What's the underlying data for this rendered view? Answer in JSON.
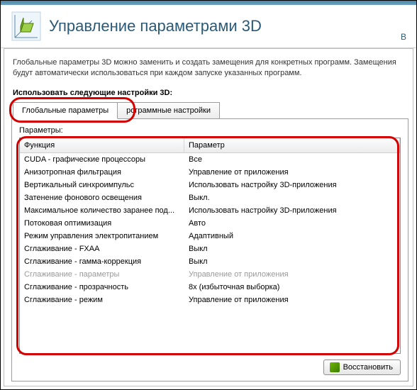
{
  "header": {
    "title": "Управление параметрами 3D",
    "right": "В"
  },
  "description": "Глобальные параметры 3D можно заменить и создать замещения для конкретных программ. Замещения будут автоматически использоваться при каждом запуске указанных программ.",
  "section_label": "Использовать следующие настройки 3D:",
  "tabs": {
    "global": "Глобальные параметры",
    "program": "рограммные настройки"
  },
  "params_label": "Параметры:",
  "columns": {
    "func": "Функция",
    "param": "Параметр"
  },
  "rows": [
    {
      "func": "CUDA - графические процессоры",
      "param": "Все",
      "disabled": false
    },
    {
      "func": "Анизотропная фильтрация",
      "param": "Управление от приложения",
      "disabled": false
    },
    {
      "func": "Вертикальный синхроимпульс",
      "param": "Использовать настройку 3D-приложения",
      "disabled": false
    },
    {
      "func": "Затенение фонового освещения",
      "param": "Выкл.",
      "disabled": false
    },
    {
      "func": "Максимальное количество заранее под...",
      "param": "Использовать настройку 3D-приложения",
      "disabled": false
    },
    {
      "func": "Потоковая оптимизация",
      "param": "Авто",
      "disabled": false
    },
    {
      "func": "Режим управления электропитанием",
      "param": "Адаптивный",
      "disabled": false
    },
    {
      "func": "Сглаживание - FXAA",
      "param": "Выкл",
      "disabled": false
    },
    {
      "func": "Сглаживание - гамма-коррекция",
      "param": "Выкл",
      "disabled": false
    },
    {
      "func": "Сглаживание - параметры",
      "param": "Управление от приложения",
      "disabled": true
    },
    {
      "func": "Сглаживание - прозрачность",
      "param": "8x (избыточная выборка)",
      "disabled": false
    },
    {
      "func": "Сглаживание - режим",
      "param": "Управление от приложения",
      "disabled": false
    }
  ],
  "footer": {
    "restore": "Восстановить"
  }
}
